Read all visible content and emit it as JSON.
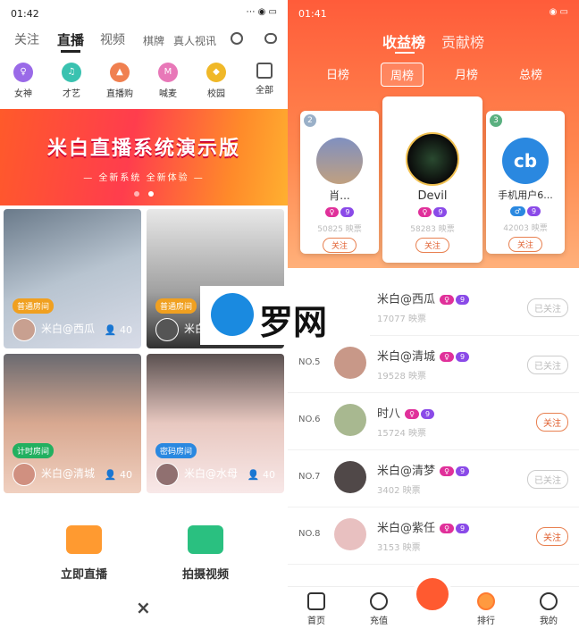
{
  "left": {
    "status": {
      "time": "01:42",
      "icons": "⋯ ◉ ▭"
    },
    "nav": {
      "follow": "关注",
      "live": "直播",
      "video": "视频",
      "chess": "棋牌",
      "real_video": "真人视讯"
    },
    "categories": [
      "女神",
      "才艺",
      "直播购",
      "喊麦",
      "校园",
      "全部"
    ],
    "banner": {
      "title": "米白直播系统演示版",
      "subtitle": "— 全新系统 全新体验 —"
    },
    "cards": [
      {
        "tag": "普通房间",
        "name": "米白@西瓜",
        "count": "40",
        "tag_color": "#f0a020"
      },
      {
        "tag": "普通房间",
        "name": "米白@",
        "count": "40",
        "tag_color": "#f0a020"
      },
      {
        "tag": "计时房间",
        "name": "米白@清城",
        "count": "40",
        "tag_color": "#22b060"
      },
      {
        "tag": "密码房间",
        "name": "米白@水母",
        "count": "40",
        "tag_color": "#2a88e0"
      }
    ],
    "actions": {
      "live": "立即直播",
      "shoot": "拍摄视频",
      "close": "×"
    }
  },
  "right": {
    "status": {
      "time": "01:41",
      "icons": "◉ ▭"
    },
    "tabs": {
      "income": "收益榜",
      "contrib": "贡献榜"
    },
    "periods": [
      "日榜",
      "周榜",
      "月榜",
      "总榜"
    ],
    "top3": [
      {
        "rank": "2",
        "name": "肖...",
        "value": "50825 映票",
        "follow": "关注"
      },
      {
        "rank": "1",
        "name": "Devil",
        "value": "58283 映票",
        "follow": "关注"
      },
      {
        "rank": "3",
        "name": "手机用户6...",
        "value": "42003 映票",
        "follow": "关注"
      }
    ],
    "level_badge": "9",
    "rows": [
      {
        "no": "",
        "name": "米白@西瓜",
        "value": "17077 映票",
        "follow": "已关注"
      },
      {
        "no": "NO.5",
        "name": "米白@清城",
        "value": "19528 映票",
        "follow": "已关注"
      },
      {
        "no": "NO.6",
        "name": "时八",
        "value": "15724 映票",
        "follow": "关注"
      },
      {
        "no": "NO.7",
        "name": "米白@清梦",
        "value": "3402 映票",
        "follow": "已关注"
      },
      {
        "no": "NO.8",
        "name": "米白@紫任",
        "value": "3153 映票",
        "follow": "关注"
      }
    ],
    "tabbar": [
      "首页",
      "充值",
      "排行",
      "我的"
    ]
  },
  "watermark": "罗网",
  "colors": {
    "accent": "#ff6a3a",
    "pink": "#e0309a",
    "purple": "#8a4ae8"
  }
}
